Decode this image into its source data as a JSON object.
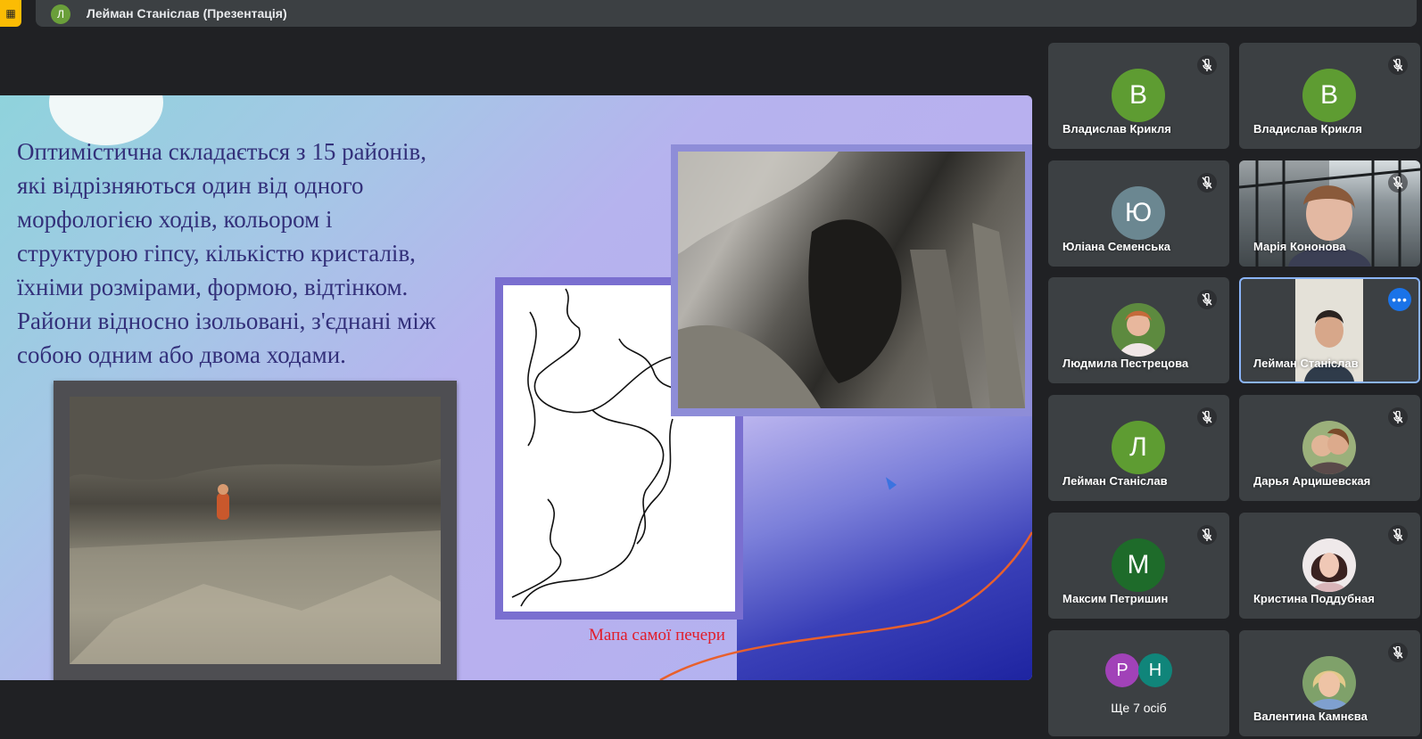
{
  "top_bar": {
    "presenter_initial": "Л",
    "presenter_title": "Лейман Станіслав (Презентація)",
    "presenter_avatar_color": "#6a9f3a"
  },
  "slide": {
    "text_lines": [
      "Оптимістична складається з 15 районів,",
      "які відрізняються один від одного",
      "морфологією ходів, кольором і",
      "структурою гіпсу, кількістю кристалів,",
      "їхніми розмірами, формою, відтінком.",
      "Райони відносно ізольовані, з'єднані між",
      "собою одним або двома ходами."
    ],
    "caption": "Мапа самої печери"
  },
  "participants": [
    {
      "name": "Владислав Крикля",
      "initial": "В",
      "avatar_color": "#5e9c32",
      "muted": true
    },
    {
      "name": "Владислав Крикля",
      "initial": "В",
      "avatar_color": "#5e9c32",
      "muted": true
    },
    {
      "name": "Юліана Семенська",
      "initial": "Ю",
      "avatar_color": "#6b8791",
      "muted": true
    },
    {
      "name": "Марія Кононова",
      "video": true,
      "muted": true
    },
    {
      "name": "Людмила Пестрецова",
      "photo": true,
      "muted": true
    },
    {
      "name": "Лейман Станіслав",
      "video": true,
      "selected": true,
      "muted": false
    },
    {
      "name": "Лейман Станіслав",
      "initial": "Л",
      "avatar_color": "#5e9c32",
      "muted": true
    },
    {
      "name": "Дарья Арцишевская",
      "photo": true,
      "muted": true
    },
    {
      "name": "Максим Петришин",
      "initial": "М",
      "avatar_color": "#1e6b2a",
      "muted": true
    },
    {
      "name": "Кристина Поддубная",
      "photo": true,
      "muted": true
    },
    {
      "name": "Валентина Камнєва",
      "photo": true,
      "muted": true
    }
  ],
  "more": {
    "label": "Ще 7 осіб",
    "initials": [
      "Р",
      "Н"
    ],
    "colors": [
      "#a142b8",
      "#10857a"
    ]
  }
}
